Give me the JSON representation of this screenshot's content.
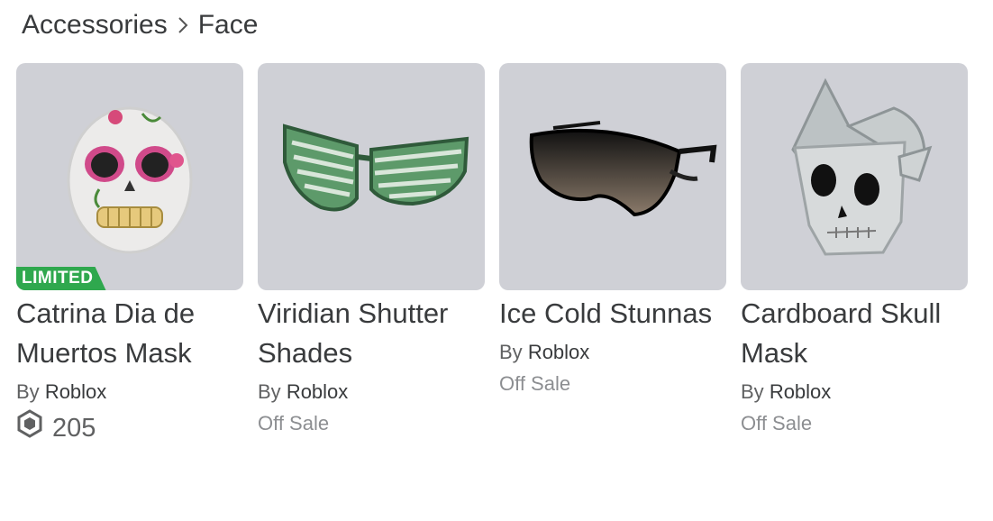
{
  "breadcrumb": {
    "parent": "Accessories",
    "current": "Face"
  },
  "items": [
    {
      "name": "Catrina Dia de Muertos Mask",
      "by_label": "By",
      "creator": "Roblox",
      "badge": "LIMITED",
      "price": "205",
      "status": ""
    },
    {
      "name": "Viridian Shutter Shades",
      "by_label": "By",
      "creator": "Roblox",
      "status": "Off Sale"
    },
    {
      "name": "Ice Cold Stunnas",
      "by_label": "By",
      "creator": "Roblox",
      "status": "Off Sale"
    },
    {
      "name": "Cardboard Skull Mask",
      "by_label": "By",
      "creator": "Roblox",
      "status": "Off Sale"
    }
  ],
  "icons": {
    "breadcrumb_separator": "chevron-right-icon",
    "currency": "robux-icon"
  },
  "colors": {
    "thumb_bg": "#cfd0d6",
    "limited_badge": "#2fa84e",
    "text_primary": "#393b3d",
    "text_secondary": "#606162"
  }
}
